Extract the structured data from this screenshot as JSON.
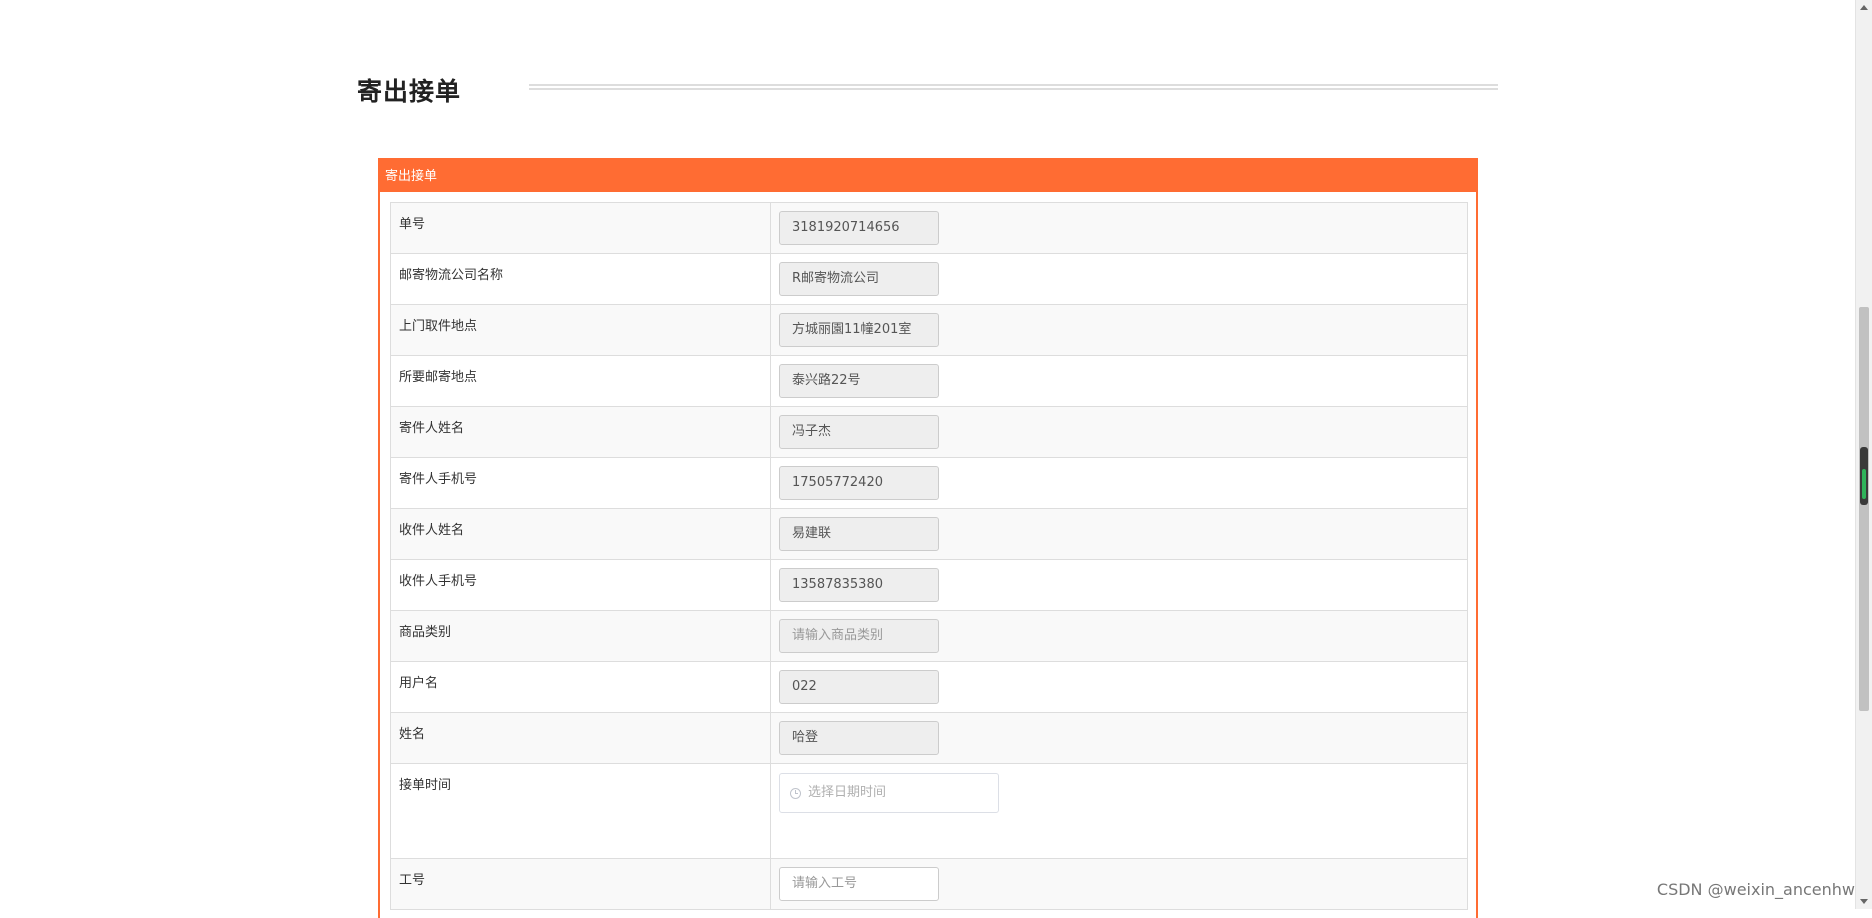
{
  "page": {
    "title": "寄出接单"
  },
  "panel": {
    "header": "寄出接单"
  },
  "form": {
    "rows": [
      {
        "label": "单号",
        "value": "3181920714656"
      },
      {
        "label": "邮寄物流公司名称",
        "value": "R邮寄物流公司"
      },
      {
        "label": "上门取件地点",
        "value": "方城丽園11幢201室"
      },
      {
        "label": "所要邮寄地点",
        "value": "泰兴路22号"
      },
      {
        "label": "寄件人姓名",
        "value": "冯子杰"
      },
      {
        "label": "寄件人手机号",
        "value": "17505772420"
      },
      {
        "label": "收件人姓名",
        "value": "易建联"
      },
      {
        "label": "收件人手机号",
        "value": "13587835380"
      },
      {
        "label": "商品类别",
        "placeholder": "请输入商品类别"
      },
      {
        "label": "用户名",
        "value": "022"
      },
      {
        "label": "姓名",
        "value": "哈登"
      },
      {
        "label": "接单时间",
        "placeholder": "选择日期时间"
      },
      {
        "label": "工号",
        "placeholder": "请输入工号"
      }
    ]
  },
  "watermark": "CSDN @weixin_ancenhw"
}
